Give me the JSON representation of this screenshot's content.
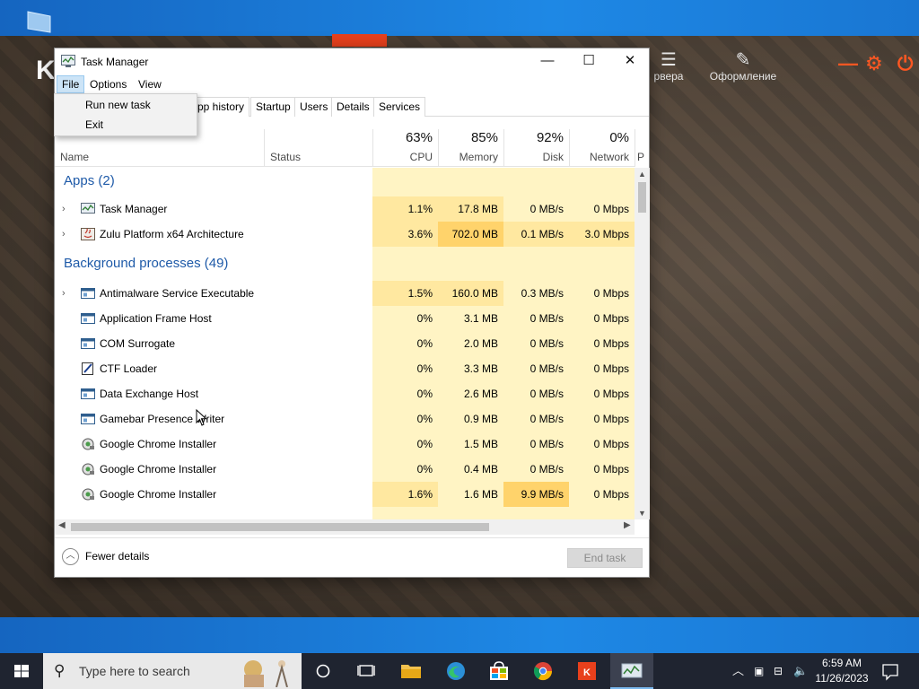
{
  "window": {
    "title": "Task Manager",
    "minimize_glyph": "—",
    "maximize_glyph": "☐",
    "close_glyph": "✕"
  },
  "menu": {
    "file": "File",
    "options": "Options",
    "view": "View",
    "file_dropdown": [
      "Run new task",
      "Exit"
    ]
  },
  "tabs": [
    "pp history",
    "Startup",
    "Users",
    "Details",
    "Services"
  ],
  "columns": {
    "name": "Name",
    "status": "Status",
    "cpu": {
      "pct": "63%",
      "label": "CPU"
    },
    "memory": {
      "pct": "85%",
      "label": "Memory"
    },
    "disk": {
      "pct": "92%",
      "label": "Disk"
    },
    "network": {
      "pct": "0%",
      "label": "Network"
    },
    "power_cut": "P"
  },
  "groups": {
    "apps": "Apps (2)",
    "background": "Background processes (49)"
  },
  "apps": [
    {
      "name": "Task Manager",
      "cpu": "1.1%",
      "memory": "17.8 MB",
      "disk": "0 MB/s",
      "network": "0 Mbps",
      "icon": "taskmanager-icon"
    },
    {
      "name": "Zulu Platform x64 Architecture",
      "cpu": "3.6%",
      "memory": "702.0 MB",
      "disk": "0.1 MB/s",
      "network": "3.0 Mbps",
      "icon": "java-icon"
    }
  ],
  "background": [
    {
      "name": "Antimalware Service Executable",
      "cpu": "1.5%",
      "memory": "160.0 MB",
      "disk": "0.3 MB/s",
      "network": "0 Mbps",
      "expandable": true
    },
    {
      "name": "Application Frame Host",
      "cpu": "0%",
      "memory": "3.1 MB",
      "disk": "0 MB/s",
      "network": "0 Mbps"
    },
    {
      "name": "COM Surrogate",
      "cpu": "0%",
      "memory": "2.0 MB",
      "disk": "0 MB/s",
      "network": "0 Mbps"
    },
    {
      "name": "CTF Loader",
      "cpu": "0%",
      "memory": "3.3 MB",
      "disk": "0 MB/s",
      "network": "0 Mbps"
    },
    {
      "name": "Data Exchange Host",
      "cpu": "0%",
      "memory": "2.6 MB",
      "disk": "0 MB/s",
      "network": "0 Mbps"
    },
    {
      "name": "Gamebar Presence Writer",
      "cpu": "0%",
      "memory": "0.9 MB",
      "disk": "0 MB/s",
      "network": "0 Mbps"
    },
    {
      "name": "Google Chrome Installer",
      "cpu": "0%",
      "memory": "1.5 MB",
      "disk": "0 MB/s",
      "network": "0 Mbps"
    },
    {
      "name": "Google Chrome Installer",
      "cpu": "0%",
      "memory": "0.4 MB",
      "disk": "0 MB/s",
      "network": "0 Mbps"
    },
    {
      "name": "Google Chrome Installer",
      "cpu": "1.6%",
      "memory": "1.6 MB",
      "disk": "9.9 MB/s",
      "network": "0 Mbps"
    }
  ],
  "footer": {
    "fewer_details": "Fewer details",
    "end_task": "End task"
  },
  "background_app": {
    "letter": "K",
    "servers_label": "рвера",
    "design_label": "Оформление"
  },
  "taskbar": {
    "search_placeholder": "Type here to search",
    "time": "6:59 AM",
    "date": "11/26/2023"
  },
  "colors": {
    "accent": "#1e5aa8",
    "heat_low": "#fff4c4",
    "heat_mid": "#ffe8a0",
    "heat_high": "#ffd36b",
    "brand_orange": "#e8401c"
  }
}
